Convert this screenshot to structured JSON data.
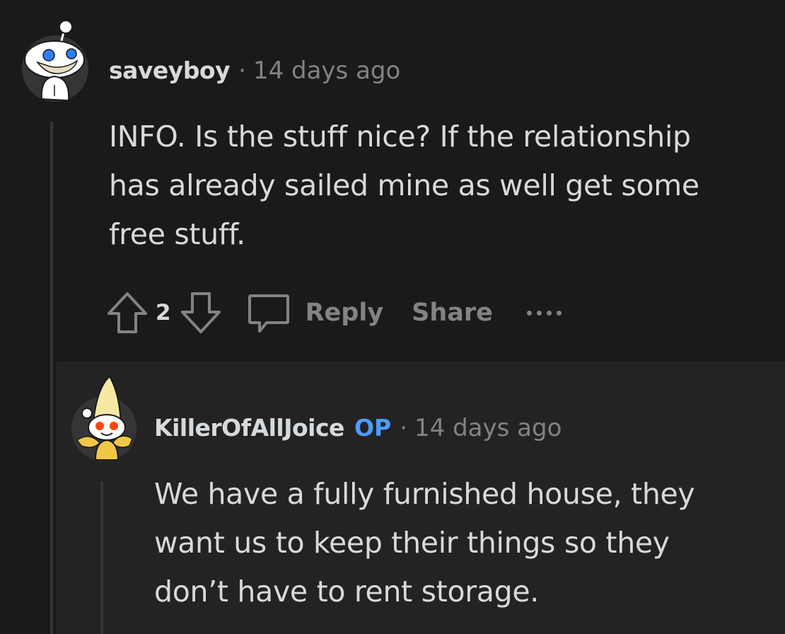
{
  "comments": [
    {
      "author": "saveyboy",
      "separator": "·",
      "time": "14 days ago",
      "body": [
        "INFO. Is the stuff nice? If the relationship",
        "has already sailed mine as well get some",
        "free stuff."
      ],
      "votes": "2",
      "actions": {
        "reply": "Reply",
        "share": "Share"
      },
      "icons": {
        "avatar": "snoo-avatar-icon",
        "upvote": "upvote-arrow-icon",
        "downvote": "downvote-arrow-icon",
        "comment": "comment-bubble-icon",
        "more": "more-options-icon"
      }
    },
    {
      "author": "KillerOfAllJoice",
      "badge": "OP",
      "separator": "·",
      "time": "14 days ago",
      "body": [
        "We have a fully furnished house, they",
        "want us to keep their things so they",
        "don’t have to rent storage."
      ],
      "icons": {
        "avatar": "banana-snoo-avatar-icon"
      }
    }
  ],
  "colors": {
    "background": "#1a1a1b",
    "nested_background": "#232324",
    "text": "#d7dadc",
    "muted": "#818384",
    "op_badge": "#4f9cf9",
    "thread_line": "#343536"
  }
}
